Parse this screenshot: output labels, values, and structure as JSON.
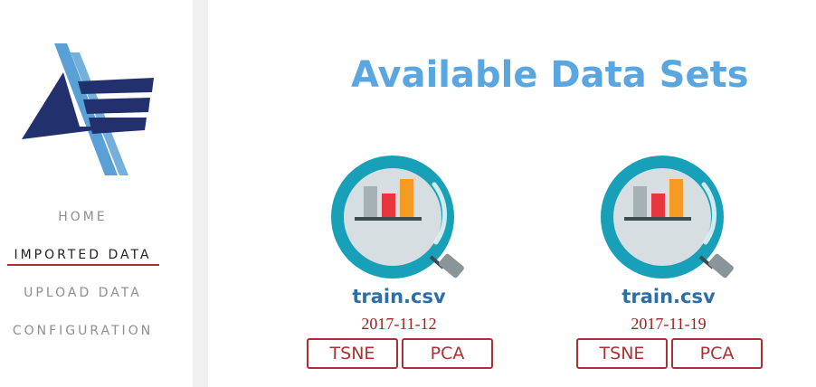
{
  "sidebar": {
    "nav": [
      {
        "label": "HOME",
        "active": false
      },
      {
        "label": "IMPORTED DATA",
        "active": true
      },
      {
        "label": "UPLOAD DATA",
        "active": false
      },
      {
        "label": "CONFIGURATION",
        "active": false
      }
    ]
  },
  "main": {
    "title": "Available Data Sets",
    "datasets": [
      {
        "filename": "train.csv",
        "date": "2017-11-12",
        "buttons": [
          "TSNE",
          "PCA"
        ]
      },
      {
        "filename": "train.csv",
        "date": "2017-11-19",
        "buttons": [
          "TSNE",
          "PCA"
        ]
      }
    ]
  },
  "colors": {
    "title": "#5aa6e0",
    "filename": "#2c6fa8",
    "date": "#a02020",
    "button_border": "#a83232",
    "active_underline": "#b03030",
    "logo_dark": "#22306e",
    "logo_light": "#3b8fcf"
  },
  "icons": {
    "logo": "stripes-logo-icon",
    "dataset": "magnifier-chart-icon"
  }
}
